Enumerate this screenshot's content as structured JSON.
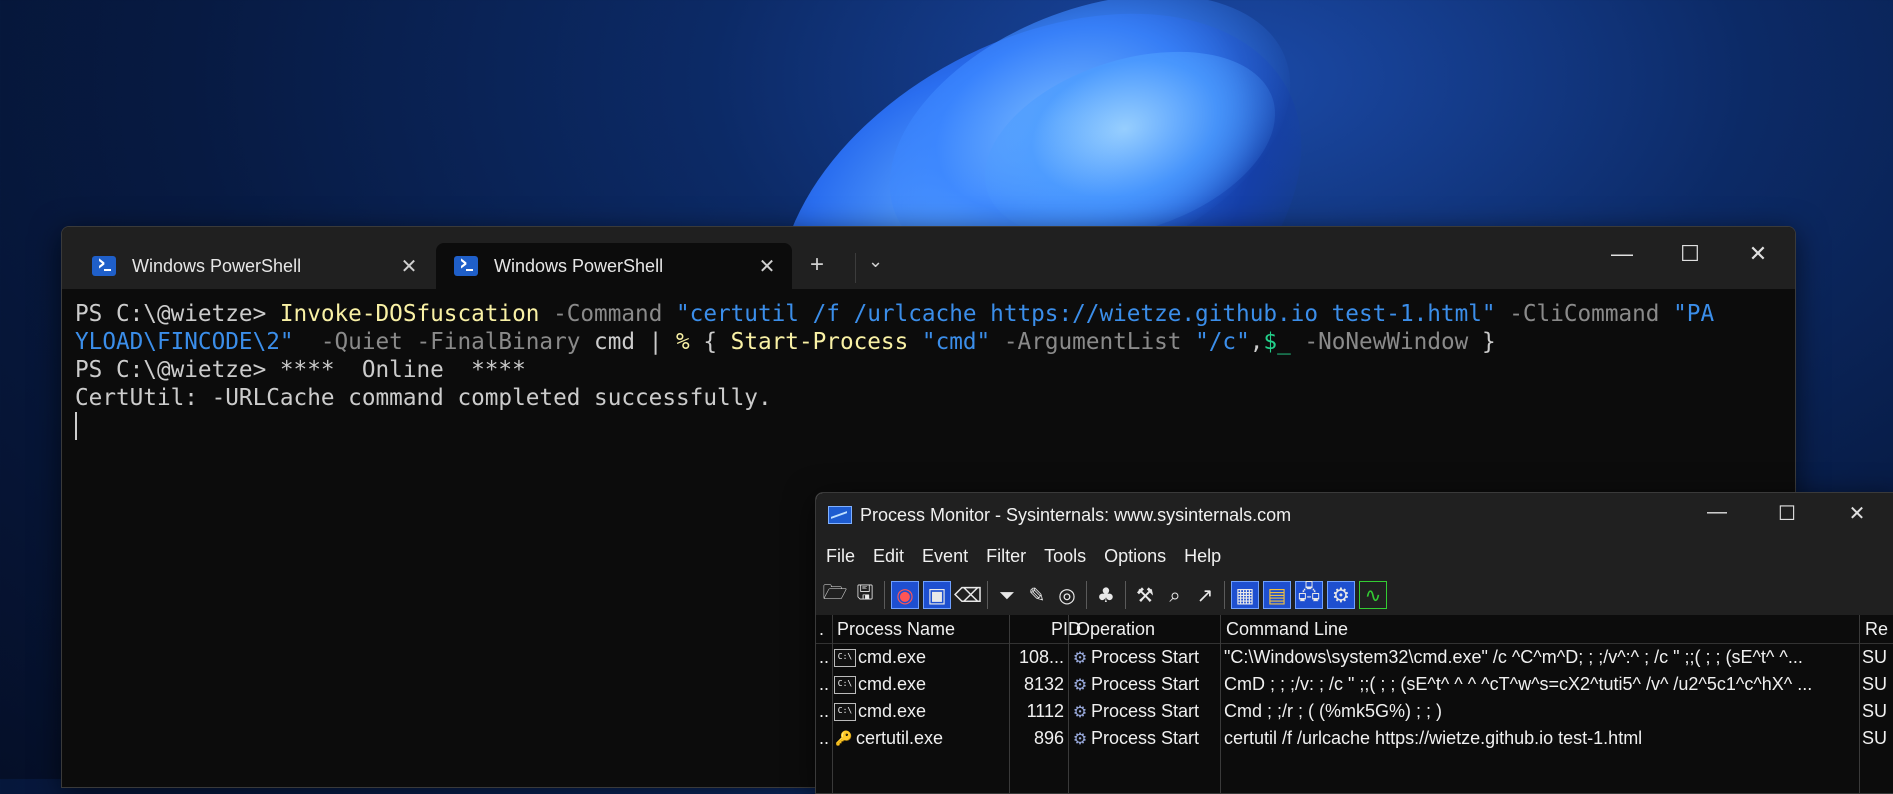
{
  "terminal": {
    "tabs": [
      {
        "label": "Windows PowerShell"
      },
      {
        "label": "Windows PowerShell"
      }
    ],
    "icons": {
      "tab": "powershell-icon",
      "close": "close-icon",
      "add": "plus-icon",
      "dropdown": "chevron-down-icon"
    },
    "window_controls": {
      "minimize": "—",
      "maximize": "☐",
      "close": "✕"
    },
    "lines": {
      "l1_prompt": "PS C:\\@wietze> ",
      "l1_cmd": "Invoke-DOSfuscation",
      "l1_p1": " -Command ",
      "l1_s1": "\"certutil /f /urlcache https://wietze.github.io test-1.html\"",
      "l1_p2": " -CliCommand ",
      "l1_s2a": "\"PA",
      "l2_s2b": "YLOAD\\FINCODE\\2\"",
      "l2_p3": "  -Quiet -FinalBinary ",
      "l2_a1": "cmd",
      "l2_pipe": " | ",
      "l2_pct": "%",
      "l2_brace": " { ",
      "l2_sp": "Start-Process",
      "l2_sp_sp": " ",
      "l2_s3": "\"cmd\"",
      "l2_p4": " -ArgumentList ",
      "l2_s4": "\"/c\"",
      "l2_comma": ",",
      "l2_var": "$_",
      "l2_p5": " -NoNewWindow",
      "l2_end": " }",
      "l3": "PS C:\\@wietze> ****  Online  ****",
      "l4": "CertUtil: -URLCache command completed successfully."
    }
  },
  "procmon": {
    "title": "Process Monitor - Sysinternals: www.sysinternals.com",
    "menu": [
      "File",
      "Edit",
      "Event",
      "Filter",
      "Tools",
      "Options",
      "Help"
    ],
    "toolbar_icons": [
      "open-icon",
      "save-icon",
      "capture-icon",
      "autoscroll-icon",
      "clear-icon",
      "filter-icon",
      "highlight-icon",
      "target-icon",
      "process-tree-icon",
      "properties-icon",
      "find-icon",
      "jump-icon",
      "registry-icon",
      "filesystem-icon",
      "network-icon",
      "process-icon",
      "profiling-icon"
    ],
    "columns": [
      ".",
      "Process Name",
      "PID",
      "Operation",
      "Command Line",
      "Re"
    ],
    "rows": [
      {
        "dot": "..",
        "process": "cmd.exe",
        "pid": "108...",
        "operation": "Process Start",
        "command_line": "\"C:\\Windows\\system32\\cmd.exe\" /c ^C^m^D; ; ;/v^:^ ;  /c   \" ;;( ; ; (sE^t^  ^...",
        "result": "SU"
      },
      {
        "dot": "..",
        "process": "cmd.exe",
        "pid": "8132",
        "operation": "Process Start",
        "command_line": "CmD ; ; ;/v: ;  /c   \" ;;( ; ; (sE^t^  ^ ^ ^cT^w^s=cX2^tuti5^ /v^ /u2^5c1^c^hX^ ...",
        "result": "SU"
      },
      {
        "dot": "..",
        "process": "cmd.exe",
        "pid": "1112",
        "operation": "Process Start",
        "command_line": "Cmd ;   ;/r ;  ( (%mk5G%)  ;   ; )",
        "result": "SU"
      },
      {
        "dot": "..",
        "process": "certutil.exe",
        "pid": "896",
        "operation": "Process Start",
        "command_line": "certutil  /f /urlcache https://wietze.github.io test-1.html",
        "result": "SU"
      }
    ]
  }
}
